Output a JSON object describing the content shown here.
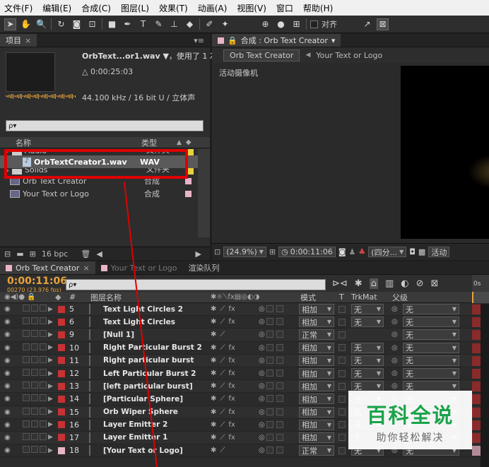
{
  "menu": [
    "文件(F)",
    "编辑(E)",
    "合成(C)",
    "图层(L)",
    "效果(T)",
    "动画(A)",
    "视图(V)",
    "窗口",
    "帮助(H)"
  ],
  "toolbar": {
    "align_label": "对齐"
  },
  "project": {
    "tab": "项目",
    "file_name": "OrbText...or1.wav",
    "used": "，使用了 1 次",
    "duration": "△ 0:00:25:03",
    "audio_info": "44.100 kHz / 16 bit U / 立体声",
    "search_placeholder": "ρ▾",
    "col_name": "名称",
    "col_type": "类型",
    "items": [
      {
        "name": "Audio",
        "type": "文件夹",
        "icon": "folder",
        "partial": true
      },
      {
        "name": "OrbTextCreator1.wav",
        "type": "WAV",
        "icon": "audio",
        "selected": true
      },
      {
        "name": "Solids",
        "type": "文件夹",
        "icon": "folder",
        "partial": true
      },
      {
        "name": "Orb Text Creator",
        "type": "合成",
        "icon": "comp",
        "swatch": "#e8b4c8"
      },
      {
        "name": "Your Text or Logo",
        "type": "合成",
        "icon": "comp",
        "swatch": "#e8b4c8"
      }
    ],
    "bpc": "16 bpc"
  },
  "composition": {
    "tab": "合成 : Orb Text Creator",
    "crumb1": "Orb Text Creator",
    "crumb2": "Your Text or Logo",
    "camera": "活动摄像机",
    "zoom": "(24.9%)",
    "time": "0:00:11:06",
    "quality": "(四分...",
    "active": "活动"
  },
  "timeline": {
    "tabs": [
      "Orb Text Creator",
      "Your Text or Logo",
      "渲染队列"
    ],
    "timecode": "0:00:11:06",
    "frames": "00270 (23.976 fps)",
    "search_placeholder": "ρ▾",
    "ruler": "0s",
    "col_num": "#",
    "col_name": "图层名称",
    "col_mode": "模式",
    "col_t": "T",
    "col_trkmat": "TrkMat",
    "col_parent": "父级",
    "layers": [
      {
        "num": "5",
        "name": "Text Light Circles 2",
        "color": "#c83232",
        "thumb": "#000000",
        "mode": "相加",
        "trkmat": "无",
        "parent": "无",
        "fx": true
      },
      {
        "num": "6",
        "name": "Text Light Circles",
        "color": "#c83232",
        "thumb": "#000000",
        "mode": "相加",
        "trkmat": "无",
        "parent": "无",
        "fx": true
      },
      {
        "num": "9",
        "name": "[Null 1]",
        "color": "#c83232",
        "thumb": "#ffffff",
        "mode": "正常",
        "trkmat": "",
        "parent": "无",
        "fx": false
      },
      {
        "num": "10",
        "name": "Right Particular Burst 2",
        "color": "#c83232",
        "thumb": "#000000",
        "mode": "相加",
        "trkmat": "无",
        "parent": "无",
        "fx": true
      },
      {
        "num": "11",
        "name": "Right particular burst",
        "color": "#c83232",
        "thumb": "#000000",
        "mode": "相加",
        "trkmat": "无",
        "parent": "无",
        "fx": true
      },
      {
        "num": "12",
        "name": "Left Particular Burst 2",
        "color": "#c83232",
        "thumb": "#000000",
        "mode": "相加",
        "trkmat": "无",
        "parent": "无",
        "fx": true
      },
      {
        "num": "13",
        "name": "[left particular burst]",
        "color": "#c83232",
        "thumb": "#000000",
        "mode": "相加",
        "trkmat": "无",
        "parent": "无",
        "fx": true
      },
      {
        "num": "14",
        "name": "[Particular Sphere]",
        "color": "#c83232",
        "thumb": "#000000",
        "mode": "相加",
        "trkmat": "无",
        "parent": "无",
        "fx": true
      },
      {
        "num": "15",
        "name": "Orb Wiper Sphere",
        "color": "#c83232",
        "thumb": "#000000",
        "mode": "相加",
        "trkmat": "无",
        "parent": "无",
        "fx": true
      },
      {
        "num": "16",
        "name": "Layer Emitter 2",
        "color": "#c83232",
        "thumb": "#000000",
        "mode": "相加",
        "trkmat": "无",
        "parent": "无",
        "fx": true
      },
      {
        "num": "17",
        "name": "Layer Emitter 1",
        "color": "#c83232",
        "thumb": "#000000",
        "mode": "相加",
        "trkmat": "无",
        "parent": "无",
        "fx": true
      },
      {
        "num": "18",
        "name": "[Your Text or Logo]",
        "color": "#e8b4c8",
        "thumb": "comp",
        "mode": "正常",
        "trkmat": "无",
        "parent": "无",
        "fx": false
      }
    ]
  },
  "watermark": {
    "title": "百科全说",
    "subtitle": "助你轻松解决"
  }
}
